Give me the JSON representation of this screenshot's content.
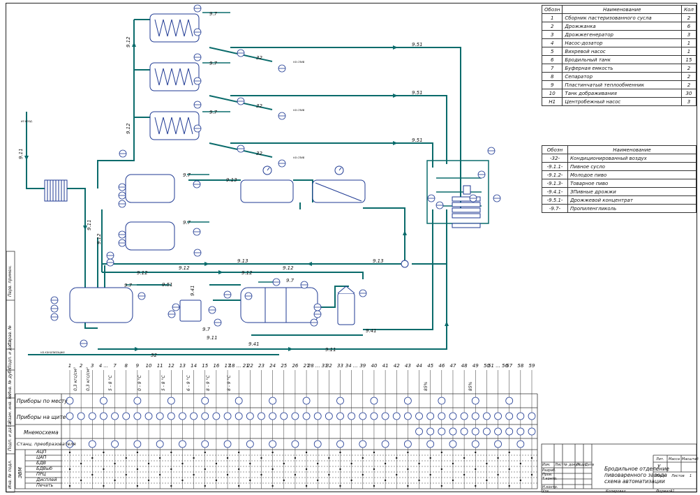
{
  "spec_table_1": {
    "headers": [
      "Обозн",
      "Наименование",
      "Кол"
    ],
    "rows": [
      [
        "1",
        "Сборник пастеризованного сусла",
        "2"
      ],
      [
        "2",
        "Дрожжанка",
        "6"
      ],
      [
        "3",
        "Дрожжегенератор",
        "3"
      ],
      [
        "4",
        "Насос-дозатор",
        "1"
      ],
      [
        "5",
        "Вихревой насос",
        "1"
      ],
      [
        "6",
        "Бродильный танк",
        "15"
      ],
      [
        "7",
        "Буферная емкость",
        "2"
      ],
      [
        "8",
        "Сепаратор",
        "2"
      ],
      [
        "9",
        "Пластинчатый теплообменник",
        "2"
      ],
      [
        "10",
        "Танк дображивания",
        "30"
      ],
      [
        "Н1",
        "Центробежный насос",
        "3"
      ]
    ]
  },
  "spec_table_2": {
    "headers": [
      "Обозн",
      "Наименование"
    ],
    "rows": [
      [
        "-32-",
        "Кондиционированный воздух"
      ],
      [
        "-9.1.1-",
        "Пивное сусло"
      ],
      [
        "-9.1.2-",
        "Молодое пиво"
      ],
      [
        "-9.1.3-",
        "Товарное пиво"
      ],
      [
        "-9.4.1-",
        "ЗПивные дрожжи"
      ],
      [
        "-9.5.1-",
        "Дрожжевой концентрат"
      ],
      [
        "-9.7-",
        "Пропиленгликоль"
      ]
    ]
  },
  "line_codes": {
    "c912": "9.12",
    "c911": "9.11",
    "c913": "9.13",
    "c941": "9.41",
    "c951": "9.51",
    "c97": "9.7",
    "c32": "32"
  },
  "small_notes": {
    "air_in": "из возд.",
    "to_drain": "на слив",
    "to_sewer": "на канализацию"
  },
  "control_table": {
    "row_labels": [
      "Приборы по месту",
      "Приборы на щите",
      "Мнемосхема",
      "Станц. преобразователя"
    ],
    "dev_row_labels": [
      "АЦП",
      "ЦАП",
      "БДВ",
      "БДВыб",
      "ПРЦ",
      "Дисплей",
      "Печать"
    ],
    "zvm_label": "ЭВМ",
    "column_numbers": [
      "1",
      "2",
      "3",
      "4 ...",
      "7",
      "8",
      "9",
      "10",
      "11",
      "12",
      "13",
      "14",
      "15",
      "16",
      "17",
      "18 ... 21",
      "22",
      "23",
      "24",
      "25",
      "26",
      "27",
      "28 ... 31",
      "32",
      "33",
      "34 ...",
      "39",
      "40",
      "41",
      "42",
      "43",
      "44",
      "45",
      "46",
      "47",
      "48",
      "49",
      "50",
      "51 ... 56",
      "57",
      "58",
      "59"
    ],
    "params": [
      "0,3 кгс/см²",
      "0,3 кгс/см²",
      "5 - 8 °С",
      "0 - 9 °С",
      "5 - 8 °С",
      "6 - 9 °С",
      "8 - 9 °С",
      "8 - 9 °С"
    ],
    "percent_label": "85%"
  },
  "title_block": {
    "title_lines": [
      "Бродильное отделение",
      "пивоваренного завода",
      "схема автоматизации"
    ],
    "col_headers": [
      "Изм.",
      "Лист",
      "№ докум.",
      "Подп.",
      "Дата"
    ],
    "role_labels": [
      "Разраб.",
      "Пров.",
      "Т.контр.",
      "",
      "Н.контр.",
      "Утв."
    ],
    "lit_header": [
      "Лит.",
      "Масса",
      "Масштаб"
    ],
    "lit_value": "У",
    "sheet_label": "Лист",
    "sheets_label": "Листов",
    "sheets_value": "1",
    "copied_label": "Копировал",
    "format_label": "Формат",
    "format_value": "А1"
  },
  "side_stamp_labels": [
    "Перв. примен.",
    "Справ. №",
    "Подп. и дата",
    "Инв. № дубл.",
    "Взам. инв. №",
    "Подп. и дата",
    "Инв. № подл."
  ],
  "colors": {
    "pipe": "#0a6b6b",
    "instrument": "#1f3a93",
    "frame": "#222222"
  }
}
